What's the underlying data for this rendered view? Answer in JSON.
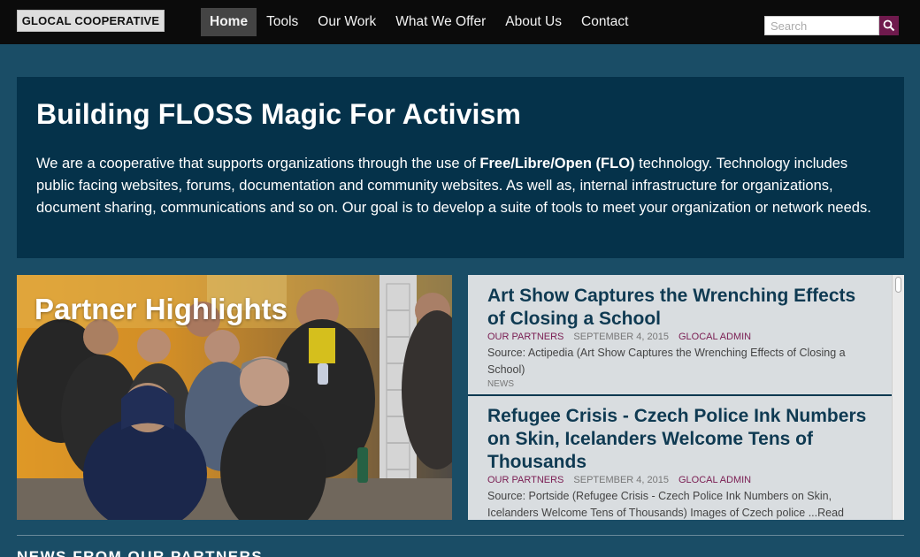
{
  "header": {
    "logo_text": "GLOCAL COOPERATIVE",
    "nav": [
      "Home",
      "Tools",
      "Our Work",
      "What We Offer",
      "About Us",
      "Contact"
    ],
    "active_nav": "Home",
    "search_placeholder": "Search",
    "search_icon": "magnifier-icon"
  },
  "hero": {
    "title": "Building FLOSS Magic For Activism",
    "body_before": "We are a cooperative that supports organizations through the use of ",
    "body_bold": "Free/Libre/Open (FLO)",
    "body_after": " technology. Technology includes public facing websites, forums, documentation and community websites. As well as, internal infrastructure for organizations, document sharing, communications and so on. Our goal is to develop a suite of tools to meet your organization or network needs."
  },
  "partner_highlights": {
    "title": "Partner Highlights"
  },
  "news": [
    {
      "title": "Art Show Captures the Wrenching Effects of Closing a School",
      "category": "OUR PARTNERS",
      "date": "SEPTEMBER 4, 2015",
      "author": "GLOCAL ADMIN",
      "source": "Source: Actipedia (Art Show Captures the Wrenching Effects of Closing a School)",
      "tag": "NEWS"
    },
    {
      "title": "Refugee Crisis - Czech Police Ink Numbers on Skin, Icelanders Welcome Tens of Thousands",
      "category": "OUR PARTNERS",
      "date": "SEPTEMBER 4, 2015",
      "author": "GLOCAL ADMIN",
      "source": "Source: Portside (Refugee Crisis - Czech Police Ink Numbers on Skin, Icelanders Welcome Tens of Thousands) Images of Czech police ...Read"
    }
  ],
  "section_heading": "NEWS FROM OUR PARTNERS",
  "colors": {
    "page_bg": "#1a4d66",
    "hero_bg": "#05324a",
    "topbar_bg": "#0b0b0b",
    "accent": "#7a1d52",
    "news_title": "#0f3a52"
  }
}
